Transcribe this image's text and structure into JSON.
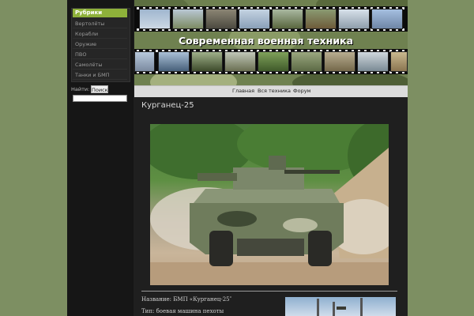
{
  "site": {
    "title": "Современная военная техника"
  },
  "sidebar": {
    "heading": "Рубрики",
    "items": [
      {
        "label": "Вертолёты"
      },
      {
        "label": "Корабли"
      },
      {
        "label": "Оружие"
      },
      {
        "label": "ПВО"
      },
      {
        "label": "Самолёты"
      },
      {
        "label": "Танки и БМП"
      }
    ],
    "search": {
      "label": "Найти:",
      "button": "Поиск",
      "value": ""
    }
  },
  "nav": {
    "items": [
      {
        "label": "Главная"
      },
      {
        "label": "Вся техника"
      },
      {
        "label": "Форум"
      }
    ]
  },
  "post": {
    "title": "Курганец-25",
    "photo_icon": "armored-vehicle-photo",
    "lines": [
      "Название: БМП «Курганец-25″",
      "Тип: боевая машина пехоты"
    ]
  },
  "colors": {
    "background": "#7d8f62",
    "accent": "#8eb13a",
    "page": "#1f1f1f"
  }
}
